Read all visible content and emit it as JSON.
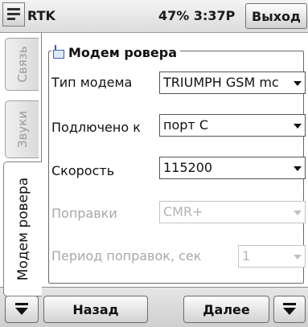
{
  "titlebar": {
    "app_title": "RTK",
    "status": "47% 3:37P",
    "exit_label": "Выход"
  },
  "tabs": [
    {
      "label": "Связь",
      "active": false
    },
    {
      "label": "Звуки",
      "active": false
    },
    {
      "label": "Модем ровера",
      "active": true
    }
  ],
  "group": {
    "title": "Модем ровера",
    "icon": "modem-icon"
  },
  "fields": {
    "modem_type": {
      "label": "Тип модема",
      "value": "TRIUMPH GSM mc",
      "enabled": true
    },
    "connected_to": {
      "label": "Подлючено к",
      "value": "порт С",
      "enabled": true
    },
    "speed": {
      "label": "Скорость",
      "value": "115200",
      "enabled": true
    },
    "corrections": {
      "label": "Поправки",
      "value": "CMR+",
      "enabled": false
    },
    "correction_period": {
      "label": "Период поправок, сек",
      "value": "1",
      "enabled": false
    }
  },
  "bottombar": {
    "back_label": "Назад",
    "next_label": "Далее"
  }
}
